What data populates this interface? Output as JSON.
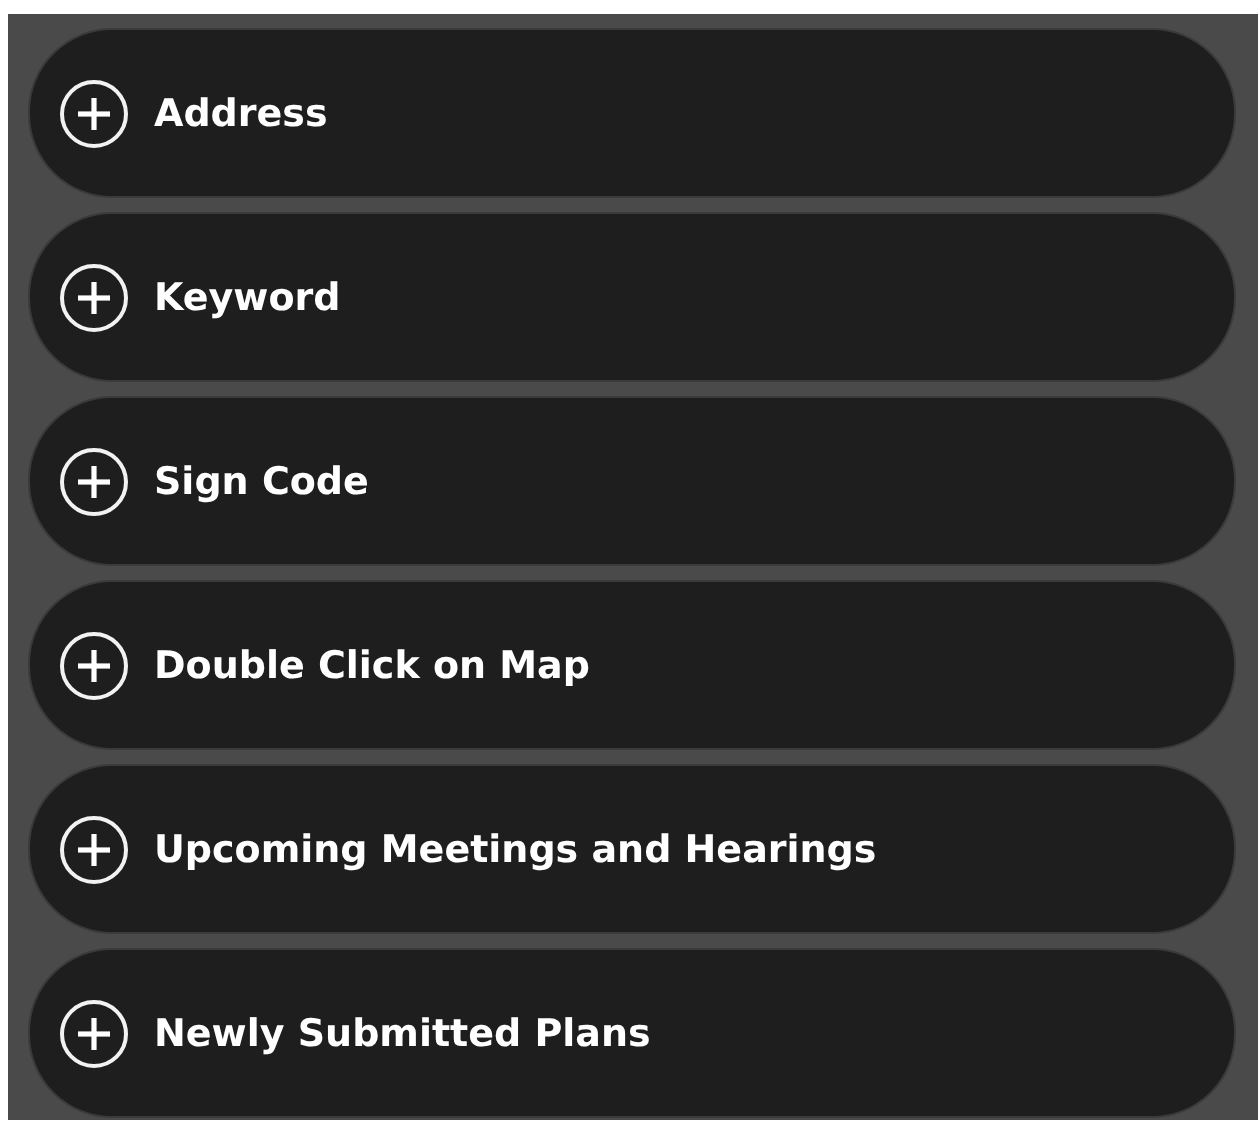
{
  "sections": [
    {
      "label": "Address",
      "expanded": false
    },
    {
      "label": "Keyword",
      "expanded": false
    },
    {
      "label": "Sign Code",
      "expanded": false
    },
    {
      "label": "Double Click on Map",
      "expanded": false
    },
    {
      "label": "Upcoming Meetings and Hearings",
      "expanded": false
    },
    {
      "label": "Newly Submitted Plans",
      "expanded": false
    }
  ]
}
